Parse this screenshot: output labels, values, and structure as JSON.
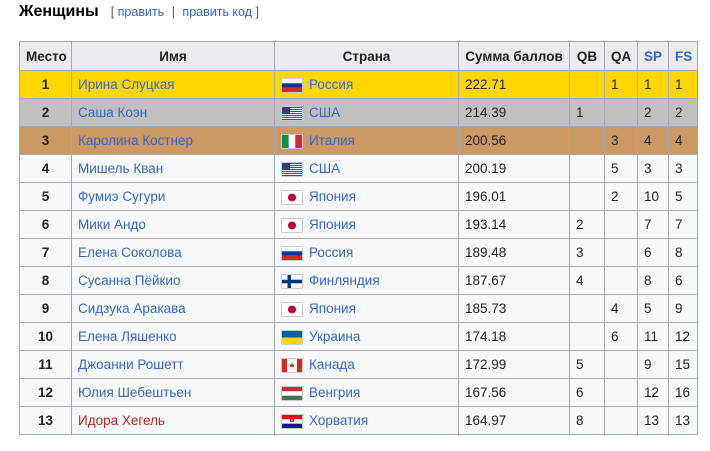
{
  "section": {
    "title": "Женщины",
    "edit_open": "[",
    "edit_label": "править",
    "separator": "|",
    "edit_code_label": "править код",
    "edit_close": "]"
  },
  "table": {
    "headers": [
      "Место",
      "Имя",
      "Страна",
      "Сумма баллов",
      "QB",
      "QA",
      "SP",
      "FS"
    ],
    "rows": [
      {
        "place": "1",
        "name": "Ирина Слуцкая",
        "country": "Россия",
        "flag": "russia-flag",
        "score": "222.71",
        "qb": "",
        "qa": "1",
        "sp": "1",
        "fs": "1"
      },
      {
        "place": "2",
        "name": "Саша Коэн",
        "country": "США",
        "flag": "usa-flag",
        "score": "214.39",
        "qb": "1",
        "qa": "",
        "sp": "2",
        "fs": "2"
      },
      {
        "place": "3",
        "name": "Каролина Костнер",
        "country": "Италия",
        "flag": "italy-flag",
        "score": "200.56",
        "qb": "",
        "qa": "3",
        "sp": "4",
        "fs": "4"
      },
      {
        "place": "4",
        "name": "Мишель Кван",
        "country": "США",
        "flag": "usa-flag",
        "score": "200.19",
        "qb": "",
        "qa": "5",
        "sp": "3",
        "fs": "3"
      },
      {
        "place": "5",
        "name": "Фумиэ Сугури",
        "country": "Япония",
        "flag": "japan-flag",
        "score": "196.01",
        "qb": "",
        "qa": "2",
        "sp": "10",
        "fs": "5"
      },
      {
        "place": "6",
        "name": "Мики Андо",
        "country": "Япония",
        "flag": "japan-flag",
        "score": "193.14",
        "qb": "2",
        "qa": "",
        "sp": "7",
        "fs": "7"
      },
      {
        "place": "7",
        "name": "Елена Соколова",
        "country": "Россия",
        "flag": "russia-flag",
        "score": "189.48",
        "qb": "3",
        "qa": "",
        "sp": "6",
        "fs": "8"
      },
      {
        "place": "8",
        "name": "Сусанна Пёйкио",
        "country": "Финляндия",
        "flag": "finland-flag",
        "score": "187.67",
        "qb": "4",
        "qa": "",
        "sp": "8",
        "fs": "6"
      },
      {
        "place": "9",
        "name": "Сидзука Аракава",
        "country": "Япония",
        "flag": "japan-flag",
        "score": "185.73",
        "qb": "",
        "qa": "4",
        "sp": "5",
        "fs": "9"
      },
      {
        "place": "10",
        "name": "Елена Ляшенко",
        "country": "Украина",
        "flag": "ukraine-flag",
        "score": "174.18",
        "qb": "",
        "qa": "6",
        "sp": "11",
        "fs": "12"
      },
      {
        "place": "11",
        "name": "Джоанни Рошетт",
        "country": "Канада",
        "flag": "canada-flag",
        "score": "172.99",
        "qb": "5",
        "qa": "",
        "sp": "9",
        "fs": "15"
      },
      {
        "place": "12",
        "name": "Юлия Шебештьен",
        "country": "Венгрия",
        "flag": "hungary-flag",
        "score": "167.56",
        "qb": "6",
        "qa": "",
        "sp": "12",
        "fs": "16"
      },
      {
        "place": "13",
        "name": "Идора Хегель",
        "country": "Хорватия",
        "flag": "croatia-flag",
        "score": "164.97",
        "qb": "8",
        "qa": "",
        "sp": "13",
        "fs": "13"
      }
    ]
  },
  "colors": {
    "gold": "#ffd700",
    "silver": "#c0c0c0",
    "bronze": "#cc9966",
    "link": "#3366cc",
    "redlink": "#bb2222"
  }
}
